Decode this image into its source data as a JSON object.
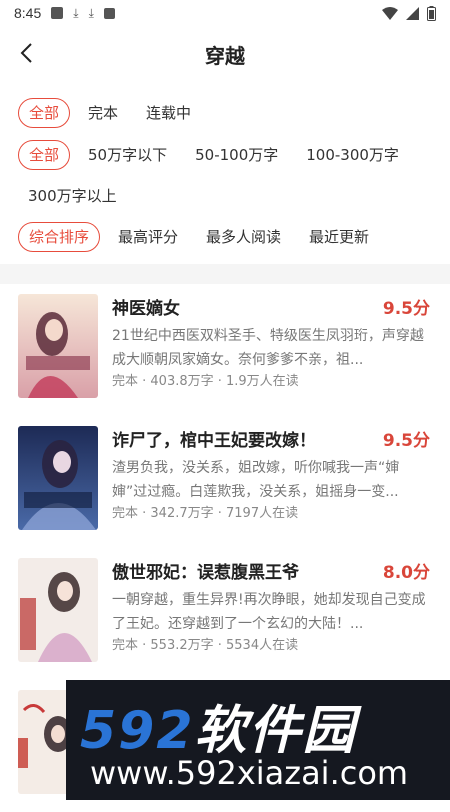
{
  "status_bar": {
    "time": "8:45"
  },
  "header": {
    "title": "穿越"
  },
  "filters": {
    "status": [
      "全部",
      "完本",
      "连载中"
    ],
    "length": [
      "全部",
      "50万字以下",
      "50-100万字",
      "100-300万字"
    ],
    "length_more": [
      "300万字以上"
    ],
    "sort": [
      "综合排序",
      "最高评分",
      "最多人阅读",
      "最近更新"
    ]
  },
  "books": [
    {
      "title": "神医嫡女",
      "score": "9.5分",
      "desc": "21世纪中西医双料圣手、特级医生凤羽珩，声穿越成大顺朝凤家嫡女。奈何爹爹不亲，祖...",
      "meta": "完本 · 403.8万字 · 1.9万人在读"
    },
    {
      "title": "诈尸了，棺中王妃要改嫁！",
      "score": "9.5分",
      "desc": "渣男负我，没关系，姐改嫁，听你喊我一声“婶婶”过过瘾。白莲欺我，没关系，姐摇身一变...",
      "meta": "完本 · 342.7万字 · 7197人在读"
    },
    {
      "title": "傲世邪妃：误惹腹黑王爷",
      "score": "8.0分",
      "desc": "一朝穿越，重生异界!再次睁眼，她却发现自己变成了王妃。还穿越到了一个玄幻的大陆！...",
      "meta": "完本 · 553.2万字 · 5534人在读"
    }
  ],
  "watermark": {
    "brand_num": "592",
    "brand_text": "软件园",
    "url": "www.592xiazai.com"
  },
  "colors": {
    "accent": "#e74c3c",
    "score": "#d9463a"
  }
}
